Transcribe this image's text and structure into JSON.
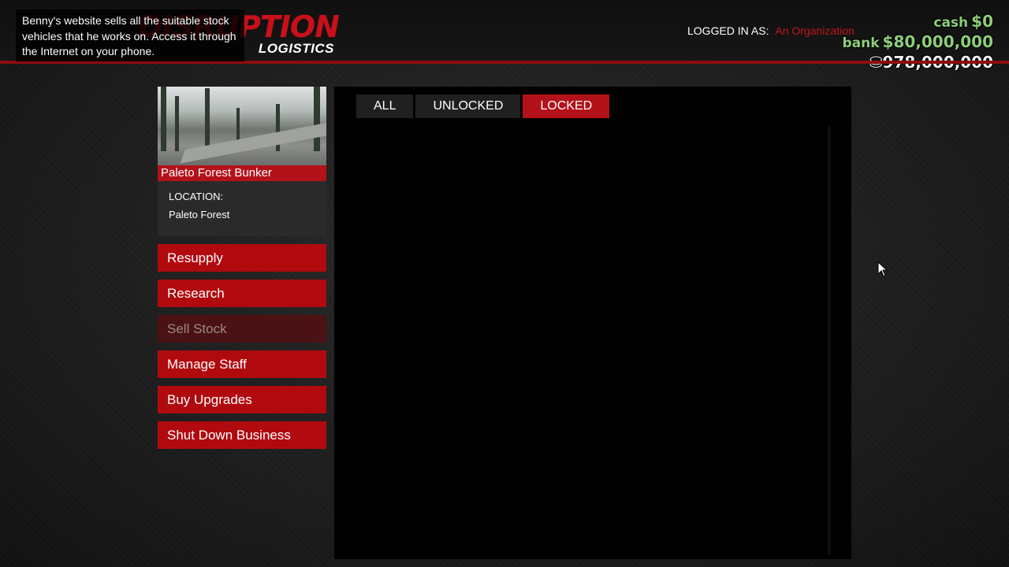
{
  "help_text": "Benny's website sells all the suitable stock vehicles that he works on. Access it through the Internet on your phone.",
  "logo": {
    "top": "DISRUPTION",
    "bottom": "LOGISTICS"
  },
  "login": {
    "label": "LOGGED IN AS:",
    "org": "An Organization"
  },
  "money": {
    "cash_label": "cash",
    "cash_value": "$0",
    "bank_label": "bank",
    "bank_value": "$80,000,000",
    "chips_value": "978,000,000"
  },
  "business": {
    "name": "Paleto Forest Bunker",
    "location_label": "LOCATION:",
    "location_value": "Paleto Forest"
  },
  "menu": [
    {
      "label": "Resupply",
      "enabled": true
    },
    {
      "label": "Research",
      "enabled": true
    },
    {
      "label": "Sell Stock",
      "enabled": false
    },
    {
      "label": "Manage Staff",
      "enabled": true
    },
    {
      "label": "Buy Upgrades",
      "enabled": true
    },
    {
      "label": "Shut Down Business",
      "enabled": true
    }
  ],
  "tabs": [
    {
      "label": "ALL",
      "active": false
    },
    {
      "label": "UNLOCKED",
      "active": false
    },
    {
      "label": "LOCKED",
      "active": true
    }
  ],
  "colors": {
    "accent_red": "#b3121a",
    "money_green": "#8dcf7a",
    "org_red": "#c0151c"
  }
}
